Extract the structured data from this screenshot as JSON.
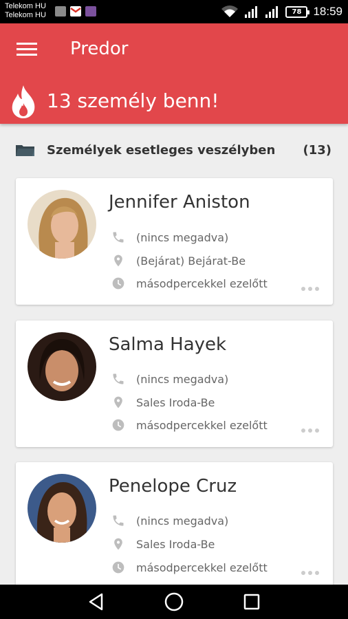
{
  "status_bar": {
    "carriers": [
      "Telekom HU",
      "Telekom HU"
    ],
    "battery": "78",
    "time": "18:59"
  },
  "app_bar": {
    "title": "Predor",
    "alert": "13 személy benn!"
  },
  "section": {
    "title": "Személyek esetleges veszélyben",
    "count": "(13)"
  },
  "people": [
    {
      "name": "Jennifer Aniston",
      "phone": "(nincs megadva)",
      "location": "(Bejárat) Bejárat-Be",
      "time": "másodpercekkel ezelőtt"
    },
    {
      "name": "Salma Hayek",
      "phone": "(nincs megadva)",
      "location": "Sales Iroda-Be",
      "time": "másodpercekkel ezelőtt"
    },
    {
      "name": "Penelope Cruz",
      "phone": "(nincs megadva)",
      "location": "Sales Iroda-Be",
      "time": "másodpercekkel ezelőtt"
    }
  ],
  "colors": {
    "primary": "#e2474b",
    "background": "#eeeeee",
    "icon_grey": "#bdbdbd"
  }
}
